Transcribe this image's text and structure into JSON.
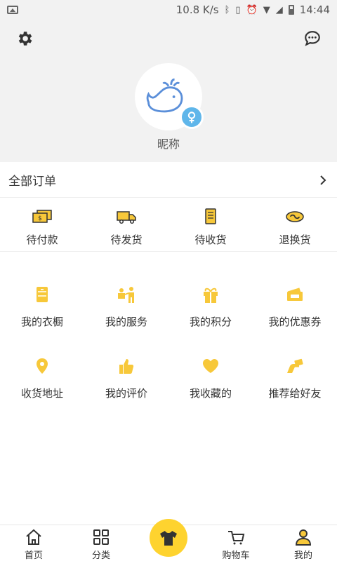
{
  "status_bar": {
    "speed": "10.8 K/s",
    "time": "14:44"
  },
  "profile": {
    "nickname": "昵称"
  },
  "orders": {
    "title": "全部订单",
    "statuses": [
      {
        "label": "待付款",
        "icon": "cash-icon"
      },
      {
        "label": "待发货",
        "icon": "truck-icon"
      },
      {
        "label": "待收货",
        "icon": "receipt-icon"
      },
      {
        "label": "退换货",
        "icon": "exchange-icon"
      }
    ]
  },
  "services": [
    {
      "label": "我的衣橱",
      "icon": "wardrobe-icon"
    },
    {
      "label": "我的服务",
      "icon": "service-icon"
    },
    {
      "label": "我的积分",
      "icon": "gift-icon"
    },
    {
      "label": "我的优惠券",
      "icon": "coupon-icon"
    },
    {
      "label": "收货地址",
      "icon": "location-icon"
    },
    {
      "label": "我的评价",
      "icon": "thumbs-up-icon"
    },
    {
      "label": "我收藏的",
      "icon": "heart-icon"
    },
    {
      "label": "推荐给好友",
      "icon": "share-hand-icon"
    }
  ],
  "bottom_nav": {
    "home": "首页",
    "category": "分类",
    "cart": "购物车",
    "mine": "我的"
  },
  "colors": {
    "accent": "#fed32f",
    "icon_yellow": "#f7c83a",
    "avatar_blue": "#5b8fd9",
    "badge_blue": "#5fb6ea"
  }
}
